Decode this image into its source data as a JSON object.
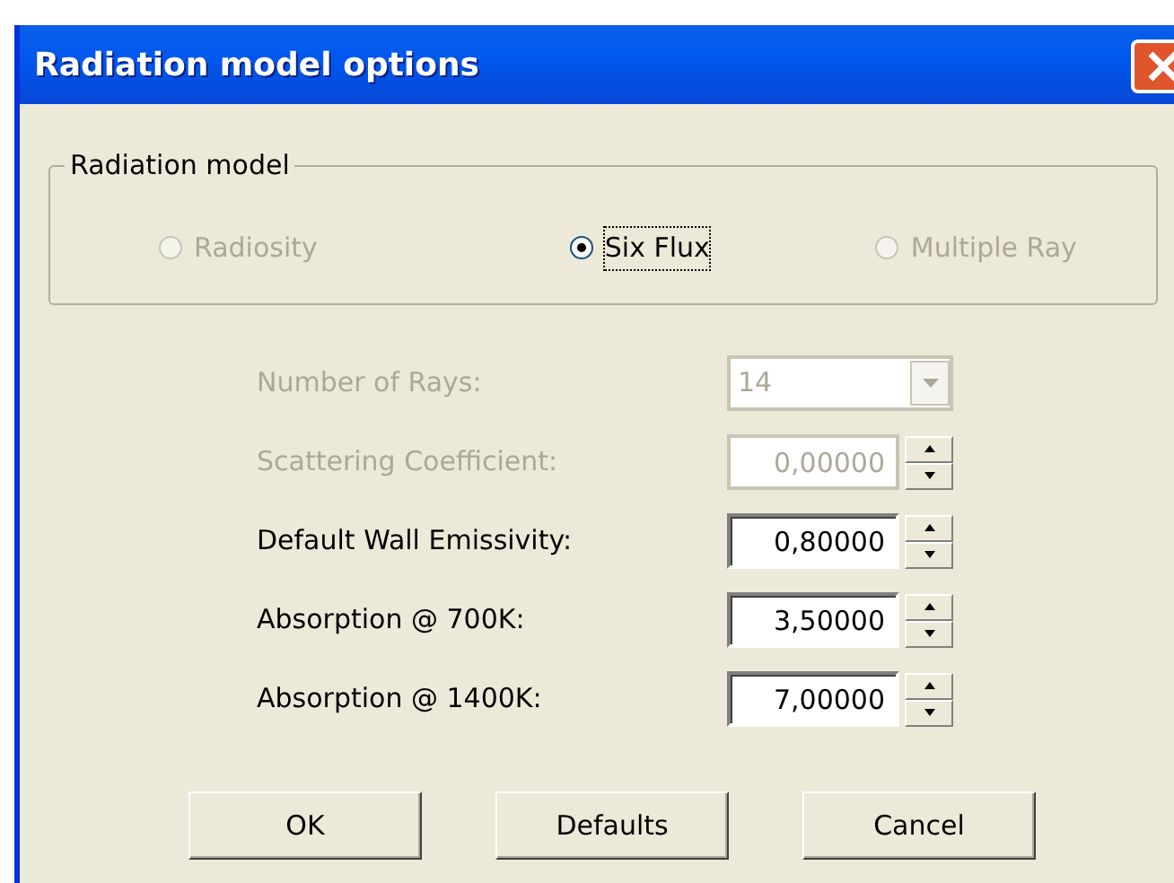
{
  "window": {
    "title": "Radiation model options"
  },
  "group": {
    "title": "Radiation model",
    "options": [
      {
        "label": "Radiosity",
        "selected": false,
        "disabled": true
      },
      {
        "label": "Six Flux",
        "selected": true,
        "disabled": false
      },
      {
        "label": "Multiple Ray",
        "selected": false,
        "disabled": true
      }
    ]
  },
  "fields": [
    {
      "kind": "combo",
      "label": "Number of Rays:",
      "value": "14",
      "disabled": true
    },
    {
      "kind": "spin",
      "label": "Scattering Coefficient:",
      "value": "0,00000",
      "disabled": true
    },
    {
      "kind": "spin",
      "label": "Default Wall Emissivity:",
      "value": "0,80000",
      "disabled": false
    },
    {
      "kind": "spin",
      "label": "Absorption @ 700K:",
      "value": "3,50000",
      "disabled": false
    },
    {
      "kind": "spin",
      "label": "Absorption @ 1400K:",
      "value": "7,00000",
      "disabled": false
    }
  ],
  "buttons": [
    "OK",
    "Defaults",
    "Cancel"
  ]
}
